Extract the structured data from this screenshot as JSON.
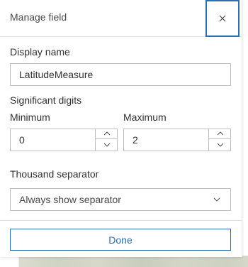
{
  "dialog": {
    "title": "Manage field",
    "close_icon": "close-icon"
  },
  "display_name": {
    "label": "Display name",
    "value": "LatitudeMeasure"
  },
  "significant_digits": {
    "label": "Significant digits",
    "minimum": {
      "label": "Minimum",
      "value": "0"
    },
    "maximum": {
      "label": "Maximum",
      "value": "2"
    },
    "up_icon": "chevron-up-icon",
    "down_icon": "chevron-down-icon"
  },
  "thousand_separator": {
    "label": "Thousand separator",
    "selected": "Always show separator",
    "icon": "chevron-down-icon"
  },
  "footer": {
    "done_label": "Done"
  },
  "colors": {
    "accent": "#2b6fb3",
    "border": "#bfbfbf",
    "text": "#323232"
  }
}
